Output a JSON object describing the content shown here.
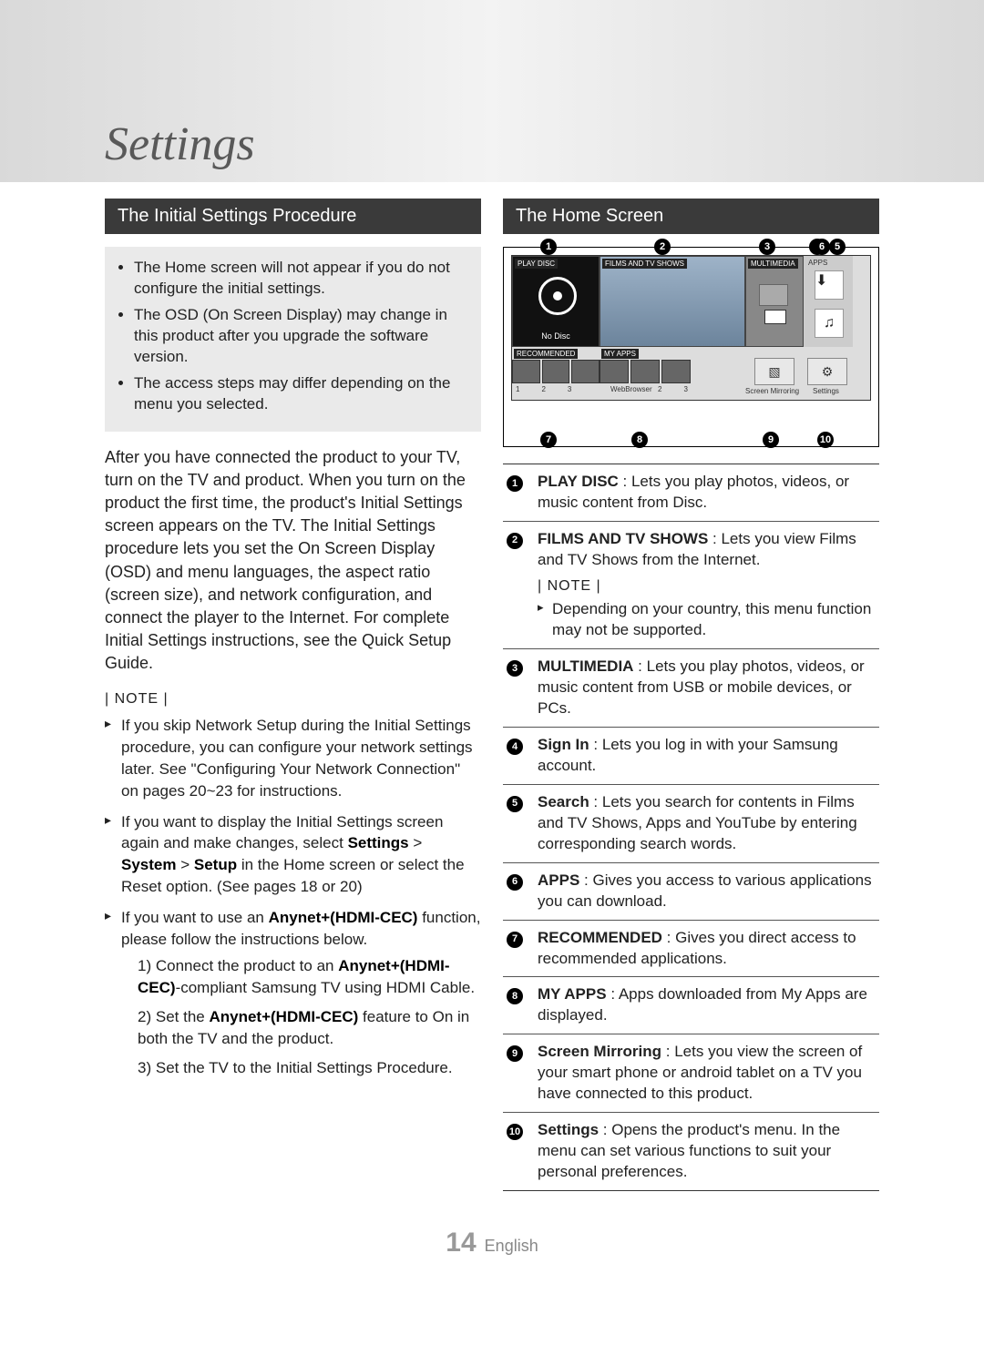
{
  "title": "Settings",
  "left": {
    "heading": "The Initial Settings Procedure",
    "box_bullets": [
      "The Home screen will not appear if you do not configure the initial settings.",
      "The OSD (On Screen Display) may change in this product after you upgrade the software version.",
      "The access steps may differ depending on the menu you selected."
    ],
    "para": "After you have connected the product to your TV, turn on the TV and product. When you turn on the product the first time, the product's Initial Settings screen appears on the TV. The Initial Settings procedure lets you set the On Screen Display (OSD) and menu languages, the aspect ratio (screen size), and network configuration, and connect the player to the Internet. For complete Initial Settings instructions, see the Quick Setup Guide.",
    "note_label": "| NOTE |",
    "notes": [
      {
        "text_pre": "If you skip Network Setup during the Initial Settings procedure, you can configure your network settings later. See \"Configuring Your Network Connection\" on pages 20~23 for instructions."
      },
      {
        "text_pre": "If you want to display the Initial Settings screen again and make changes, select ",
        "bold1": "Settings",
        "mid1": " > ",
        "bold2": "System",
        "mid2": " > ",
        "bold3": "Setup",
        "text_post": " in the Home screen or select the Reset option. (See pages 18 or 20)"
      },
      {
        "text_pre": "If you want to use an ",
        "bold1": "Anynet+(HDMI-CEC)",
        "text_post": " function, please follow the instructions below.",
        "sub": [
          {
            "n": "1)",
            "pre": "Connect the product to an ",
            "bold": "Anynet+(HDMI-CEC)",
            "post": "-compliant Samsung TV using HDMI Cable."
          },
          {
            "n": "2)",
            "pre": "Set the ",
            "bold": "Anynet+(HDMI-CEC)",
            "post": " feature to On in both the TV and the product."
          },
          {
            "n": "3)",
            "pre": "Set the TV to the Initial Settings Procedure.",
            "bold": "",
            "post": ""
          }
        ]
      }
    ]
  },
  "right": {
    "heading": "The Home Screen",
    "diagram": {
      "labels": {
        "play_disc": "PLAY DISC",
        "no_disc": "No Disc",
        "films": "FILMS AND TV SHOWS",
        "multimedia": "MULTIMEDIA",
        "apps": "APPS",
        "recommended": "RECOMMENDED",
        "my_apps": "MY APPS",
        "screen_mirror": "Screen Mirroring",
        "settings": "Settings",
        "webbrowser": "WebBrowser",
        "n1": "1",
        "n2": "2",
        "n3": "3"
      }
    },
    "legend": [
      {
        "num": "1",
        "term": "PLAY DISC",
        "text": " : Lets you play photos, videos, or music content from Disc."
      },
      {
        "num": "2",
        "term": "FILMS AND TV SHOWS",
        "text": " : Lets you view Films and TV Shows from the Internet.",
        "note_label": "| NOTE |",
        "note": "Depending on your country, this menu function may not be supported."
      },
      {
        "num": "3",
        "term": "MULTIMEDIA",
        "text": " : Lets you play photos, videos, or music content from USB or mobile devices, or PCs."
      },
      {
        "num": "4",
        "term": "Sign In",
        "text": " : Lets you log in with your Samsung account."
      },
      {
        "num": "5",
        "term": "Search",
        "text": " : Lets you search for contents in Films and TV Shows, Apps and YouTube by entering corresponding search words."
      },
      {
        "num": "6",
        "term": "APPS",
        "text": " : Gives you access to various applications you can download."
      },
      {
        "num": "7",
        "term": "RECOMMENDED",
        "text": " : Gives you direct access to recommended applications."
      },
      {
        "num": "8",
        "term": "MY APPS",
        "text": " : Apps downloaded from My Apps are displayed."
      },
      {
        "num": "9",
        "term": "Screen Mirroring",
        "text": " : Lets you view the screen of your smart phone or android tablet on a TV you have connected to this product."
      },
      {
        "num": "10",
        "term": "Settings",
        "text": " : Opens the product's menu. In the menu can set various functions to suit your personal preferences."
      }
    ]
  },
  "footer": {
    "page": "14",
    "lang": "English"
  }
}
